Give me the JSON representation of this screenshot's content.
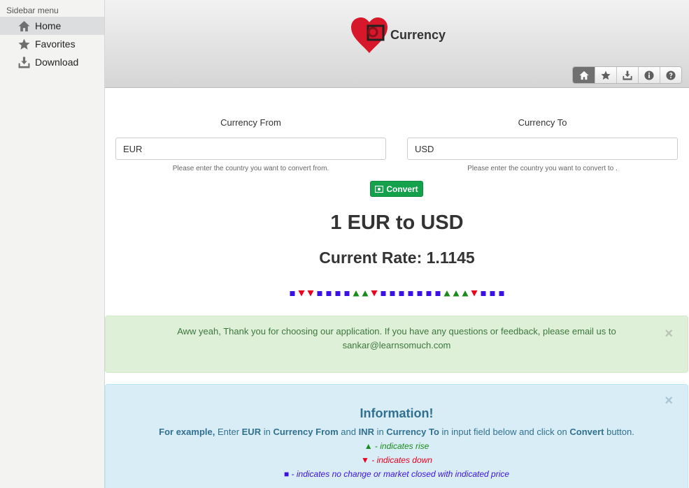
{
  "sidebar": {
    "title": "Sidebar menu",
    "items": [
      {
        "label": "Home",
        "icon": "home-icon"
      },
      {
        "label": "Favorites",
        "icon": "star-icon"
      },
      {
        "label": "Download",
        "icon": "download-icon"
      }
    ]
  },
  "header": {
    "app_name": "Currency",
    "toolbar": [
      "home-icon",
      "star-icon",
      "download-icon",
      "info-icon",
      "help-icon"
    ]
  },
  "form": {
    "from_label": "Currency From",
    "to_label": "Currency To",
    "from_value": "EUR",
    "to_value": "USD",
    "from_help": "Please enter the country you want to convert from.",
    "to_help": "Please enter the country you want to convert to .",
    "convert_label": "Convert"
  },
  "result": {
    "title": "1 EUR to USD",
    "rate": "Current Rate: 1.1145",
    "trend": [
      "flat",
      "down",
      "down",
      "flat",
      "flat",
      "flat",
      "flat",
      "up",
      "up",
      "down",
      "flat",
      "flat",
      "flat",
      "flat",
      "flat",
      "flat",
      "flat",
      "up",
      "up",
      "up",
      "down",
      "flat",
      "flat",
      "flat"
    ]
  },
  "success_alert": {
    "text": "Aww yeah, Thank you for choosing our application. If you have any questions or feedback, please email us to sankar@learnsomuch.com",
    "close": "×"
  },
  "info_alert": {
    "title": "Information!",
    "example_lead": "For example,",
    "example_t1": " Enter ",
    "example_eur": "EUR",
    "example_t2": " in ",
    "example_from": "Currency From",
    "example_t3": " and ",
    "example_inr": "INR",
    "example_t4": " in ",
    "example_to": "Currency To",
    "example_t5": " in input field below and click on ",
    "example_convert": "Convert",
    "example_t6": " button.",
    "rise_symbol": "▲",
    "rise_text": " - indicates rise",
    "down_symbol": "▼",
    "down_text": " - indicates down",
    "flat_symbol": "■",
    "flat_text": " - indicates no change or market closed with indicated price",
    "close": "×"
  },
  "colors": {
    "up": "#1a8a1a",
    "down": "#e8001c",
    "flat": "#3a10e5",
    "convert_button": "#14a14b"
  }
}
